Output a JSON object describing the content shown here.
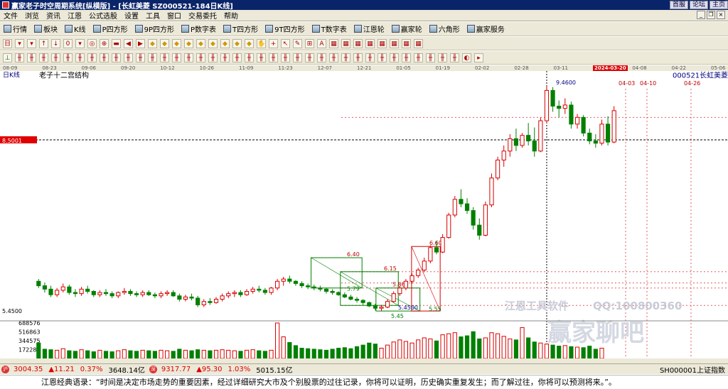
{
  "window": {
    "title": "赢家老子时空周期系统[纵横版] - [长虹美菱  SZ000521-184日K线]",
    "buttons": [
      "首服",
      "论坛",
      "主页"
    ]
  },
  "menu": [
    "文件",
    "浏览",
    "资讯",
    "江恩",
    "公式选股",
    "设置",
    "工具",
    "窗口",
    "交易委托",
    "帮助"
  ],
  "toolbar1": [
    "行情",
    "板块",
    "K线",
    "P四方形",
    "9P四方形",
    "P数字表",
    "T四方形",
    "9T四方形",
    "T数字表",
    "江恩轮",
    "赢家轮",
    "六角形",
    "赢家服务"
  ],
  "toolbar2_icons": [
    "日",
    "▾",
    "▾",
    "↑",
    "↓",
    "0",
    "▾",
    "◎",
    "⊕",
    "▬",
    "◀",
    "▶",
    "◆",
    "◆",
    "◆",
    "◆",
    "◆",
    "◆",
    "◆",
    "◆",
    "◆",
    "✋",
    "+",
    "↖",
    "✎",
    "⊞",
    "A",
    "▦",
    "▦",
    "▦",
    "▦",
    "▦",
    "▦",
    "▦",
    "▦"
  ],
  "toolbar3_icons": [
    "⊥",
    "╫",
    "╫",
    "╫",
    "╫",
    "╫",
    "╫",
    "╫",
    "╫",
    "╫",
    "╫",
    "╫",
    "╫",
    "╫",
    "╫",
    "╫",
    "╫",
    "╫",
    "╫",
    "╫",
    "╫",
    "╫",
    "╫",
    "╫",
    "╫",
    "╫",
    "╫",
    "╫",
    "╫",
    "╫",
    "╫",
    "╫",
    "╫",
    "╫",
    "╫",
    "╫",
    "╫",
    "╫",
    "◐",
    "▸"
  ],
  "colors": {
    "up": "#d80000",
    "down": "#008000",
    "bg": "#ffffff",
    "panel": "#ece9d8",
    "accent": "#000080"
  },
  "chart_data": {
    "type": "candlestick",
    "period_label": "日K线",
    "indicator_title": "老子十二宫结构",
    "security": {
      "code": "000521",
      "name": "长虹美菱"
    },
    "x_dates": [
      "08-09",
      "08-23",
      "09-06",
      "09-20",
      "10-12",
      "10-26",
      "11-09",
      "11-23",
      "12-07",
      "12-21",
      "01-05",
      "01-19",
      "02-02",
      "02-28",
      "03-11",
      "2024-03-20",
      "04-08",
      "04-22",
      "05-06"
    ],
    "highlight_date": "2024-03-20",
    "y_axis_labels": [
      "8.5001",
      "5.4500"
    ],
    "y_marker_value": 8.5001,
    "volume_axis_labels": [
      "688576",
      "516863",
      "344575",
      "172288"
    ],
    "price_annotations": [
      "9.4600",
      "6.60",
      "6.40",
      "6.15",
      "5.86",
      "5.79",
      "5.45",
      "5.4500",
      "5.55"
    ],
    "future_dates": [
      "04-03",
      "04-10",
      "04-26"
    ],
    "series": [
      {
        "open": 5.98,
        "high": 6.02,
        "low": 5.86,
        "close": 5.9
      },
      {
        "open": 5.9,
        "high": 5.96,
        "low": 5.78,
        "close": 5.84
      },
      {
        "open": 5.84,
        "high": 5.9,
        "low": 5.7,
        "close": 5.74
      },
      {
        "open": 5.74,
        "high": 5.86,
        "low": 5.7,
        "close": 5.82
      },
      {
        "open": 5.82,
        "high": 5.94,
        "low": 5.78,
        "close": 5.88
      },
      {
        "open": 5.88,
        "high": 5.92,
        "low": 5.74,
        "close": 5.78
      },
      {
        "open": 5.78,
        "high": 5.84,
        "low": 5.7,
        "close": 5.76
      },
      {
        "open": 5.76,
        "high": 5.88,
        "low": 5.72,
        "close": 5.84
      },
      {
        "open": 5.84,
        "high": 5.9,
        "low": 5.76,
        "close": 5.8
      },
      {
        "open": 5.8,
        "high": 5.82,
        "low": 5.7,
        "close": 5.74
      },
      {
        "open": 5.74,
        "high": 5.82,
        "low": 5.7,
        "close": 5.78
      },
      {
        "open": 5.78,
        "high": 5.84,
        "low": 5.72,
        "close": 5.76
      },
      {
        "open": 5.76,
        "high": 5.8,
        "low": 5.68,
        "close": 5.72
      },
      {
        "open": 5.72,
        "high": 5.8,
        "low": 5.68,
        "close": 5.78
      },
      {
        "open": 5.78,
        "high": 5.86,
        "low": 5.74,
        "close": 5.8
      },
      {
        "open": 5.8,
        "high": 5.84,
        "low": 5.72,
        "close": 5.76
      },
      {
        "open": 5.76,
        "high": 5.8,
        "low": 5.7,
        "close": 5.74
      },
      {
        "open": 5.74,
        "high": 5.82,
        "low": 5.7,
        "close": 5.78
      },
      {
        "open": 5.78,
        "high": 5.82,
        "low": 5.72,
        "close": 5.74
      },
      {
        "open": 5.74,
        "high": 5.78,
        "low": 5.68,
        "close": 5.72
      },
      {
        "open": 5.72,
        "high": 5.8,
        "low": 5.68,
        "close": 5.76
      },
      {
        "open": 5.76,
        "high": 5.82,
        "low": 5.72,
        "close": 5.78
      },
      {
        "open": 5.78,
        "high": 5.82,
        "low": 5.7,
        "close": 5.72
      },
      {
        "open": 5.72,
        "high": 5.76,
        "low": 5.62,
        "close": 5.66
      },
      {
        "open": 5.66,
        "high": 5.74,
        "low": 5.62,
        "close": 5.7
      },
      {
        "open": 5.7,
        "high": 5.76,
        "low": 5.64,
        "close": 5.68
      },
      {
        "open": 5.68,
        "high": 5.72,
        "low": 5.52,
        "close": 5.56
      },
      {
        "open": 5.56,
        "high": 5.66,
        "low": 5.52,
        "close": 5.62
      },
      {
        "open": 5.62,
        "high": 5.68,
        "low": 5.56,
        "close": 5.6
      },
      {
        "open": 5.6,
        "high": 5.7,
        "low": 5.58,
        "close": 5.66
      },
      {
        "open": 5.66,
        "high": 5.76,
        "low": 5.62,
        "close": 5.72
      },
      {
        "open": 5.72,
        "high": 5.8,
        "low": 5.68,
        "close": 5.76
      },
      {
        "open": 5.76,
        "high": 5.82,
        "low": 5.7,
        "close": 5.78
      },
      {
        "open": 5.78,
        "high": 5.82,
        "low": 5.7,
        "close": 5.74
      },
      {
        "open": 5.74,
        "high": 5.84,
        "low": 5.72,
        "close": 5.8
      },
      {
        "open": 5.8,
        "high": 5.88,
        "low": 5.76,
        "close": 5.84
      },
      {
        "open": 5.84,
        "high": 5.9,
        "low": 5.78,
        "close": 5.82
      },
      {
        "open": 5.82,
        "high": 5.86,
        "low": 5.74,
        "close": 5.78
      },
      {
        "open": 5.78,
        "high": 5.88,
        "low": 5.74,
        "close": 5.86
      },
      {
        "open": 5.86,
        "high": 6.02,
        "low": 5.82,
        "close": 5.98
      },
      {
        "open": 5.98,
        "high": 6.06,
        "low": 5.9,
        "close": 6.02
      },
      {
        "open": 6.02,
        "high": 6.08,
        "low": 5.94,
        "close": 5.98
      },
      {
        "open": 5.98,
        "high": 6.0,
        "low": 5.9,
        "close": 5.94
      },
      {
        "open": 5.94,
        "high": 5.98,
        "low": 5.86,
        "close": 5.9
      },
      {
        "open": 5.9,
        "high": 5.94,
        "low": 5.84,
        "close": 5.88
      },
      {
        "open": 5.88,
        "high": 5.92,
        "low": 5.82,
        "close": 5.86
      },
      {
        "open": 5.86,
        "high": 5.9,
        "low": 5.8,
        "close": 5.84
      },
      {
        "open": 5.84,
        "high": 5.86,
        "low": 5.76,
        "close": 5.8
      },
      {
        "open": 5.8,
        "high": 5.84,
        "low": 5.74,
        "close": 5.78
      },
      {
        "open": 5.78,
        "high": 5.8,
        "low": 5.72,
        "close": 5.74
      },
      {
        "open": 5.74,
        "high": 5.78,
        "low": 5.68,
        "close": 5.7
      },
      {
        "open": 5.7,
        "high": 5.74,
        "low": 5.64,
        "close": 5.66
      },
      {
        "open": 5.66,
        "high": 5.7,
        "low": 5.6,
        "close": 5.64
      },
      {
        "open": 5.64,
        "high": 5.66,
        "low": 5.56,
        "close": 5.6
      },
      {
        "open": 5.6,
        "high": 5.62,
        "low": 5.52,
        "close": 5.54
      },
      {
        "open": 5.54,
        "high": 5.58,
        "low": 5.46,
        "close": 5.5
      },
      {
        "open": 5.5,
        "high": 5.56,
        "low": 5.45,
        "close": 5.52
      },
      {
        "open": 5.52,
        "high": 5.66,
        "low": 5.5,
        "close": 5.62
      },
      {
        "open": 5.62,
        "high": 5.8,
        "low": 5.6,
        "close": 5.76
      },
      {
        "open": 5.76,
        "high": 5.9,
        "low": 5.72,
        "close": 5.86
      },
      {
        "open": 5.86,
        "high": 6.02,
        "low": 5.82,
        "close": 5.98
      },
      {
        "open": 5.98,
        "high": 6.12,
        "low": 5.94,
        "close": 6.08
      },
      {
        "open": 6.08,
        "high": 6.22,
        "low": 6.04,
        "close": 6.18
      },
      {
        "open": 6.18,
        "high": 6.4,
        "low": 6.14,
        "close": 6.34
      },
      {
        "open": 6.34,
        "high": 6.62,
        "low": 6.3,
        "close": 6.58
      },
      {
        "open": 6.58,
        "high": 6.7,
        "low": 6.46,
        "close": 6.5
      },
      {
        "open": 6.5,
        "high": 6.82,
        "low": 6.48,
        "close": 6.76
      },
      {
        "open": 6.76,
        "high": 7.2,
        "low": 6.74,
        "close": 7.16
      },
      {
        "open": 7.16,
        "high": 7.5,
        "low": 7.12,
        "close": 7.44
      },
      {
        "open": 7.44,
        "high": 7.62,
        "low": 7.3,
        "close": 7.36
      },
      {
        "open": 7.36,
        "high": 7.46,
        "low": 7.18,
        "close": 7.24
      },
      {
        "open": 7.24,
        "high": 7.3,
        "low": 6.9,
        "close": 6.98
      },
      {
        "open": 6.98,
        "high": 7.1,
        "low": 6.72,
        "close": 6.8
      },
      {
        "open": 6.8,
        "high": 7.4,
        "low": 6.78,
        "close": 7.34
      },
      {
        "open": 7.34,
        "high": 7.9,
        "low": 7.3,
        "close": 7.82
      },
      {
        "open": 7.82,
        "high": 8.2,
        "low": 7.78,
        "close": 8.14
      },
      {
        "open": 8.14,
        "high": 8.4,
        "low": 8.02,
        "close": 8.3
      },
      {
        "open": 8.3,
        "high": 8.6,
        "low": 8.2,
        "close": 8.52
      },
      {
        "open": 8.52,
        "high": 8.7,
        "low": 8.3,
        "close": 8.4
      },
      {
        "open": 8.4,
        "high": 8.62,
        "low": 8.36,
        "close": 8.58
      },
      {
        "open": 8.58,
        "high": 8.8,
        "low": 8.4,
        "close": 8.48
      },
      {
        "open": 8.48,
        "high": 8.72,
        "low": 8.2,
        "close": 8.3
      },
      {
        "open": 8.3,
        "high": 8.9,
        "low": 8.28,
        "close": 8.84
      },
      {
        "open": 8.84,
        "high": 9.46,
        "low": 8.8,
        "close": 9.38
      },
      {
        "open": 9.38,
        "high": 9.44,
        "low": 9.0,
        "close": 9.1
      },
      {
        "open": 9.1,
        "high": 9.2,
        "low": 8.9,
        "close": 9.06
      },
      {
        "open": 9.06,
        "high": 9.24,
        "low": 8.96,
        "close": 9.12
      },
      {
        "open": 9.12,
        "high": 9.18,
        "low": 8.7,
        "close": 8.78
      },
      {
        "open": 8.78,
        "high": 8.96,
        "low": 8.7,
        "close": 8.9
      },
      {
        "open": 8.9,
        "high": 8.94,
        "low": 8.56,
        "close": 8.62
      },
      {
        "open": 8.62,
        "high": 8.7,
        "low": 8.42,
        "close": 8.48
      },
      {
        "open": 8.48,
        "high": 8.6,
        "low": 8.36,
        "close": 8.44
      },
      {
        "open": 8.44,
        "high": 8.86,
        "low": 8.4,
        "close": 8.78
      },
      {
        "open": 8.78,
        "high": 8.92,
        "low": 8.4,
        "close": 8.46
      },
      {
        "open": 8.46,
        "high": 9.1,
        "low": 8.44,
        "close": 9.02
      }
    ],
    "volume": [
      300000,
      180000,
      170000,
      160000,
      190000,
      150000,
      140000,
      170000,
      150000,
      130000,
      160000,
      140000,
      130000,
      150000,
      170000,
      150000,
      140000,
      160000,
      150000,
      140000,
      160000,
      150000,
      140000,
      180000,
      160000,
      150000,
      170000,
      160000,
      150000,
      160000,
      170000,
      160000,
      150000,
      140000,
      160000,
      170000,
      150000,
      140000,
      160000,
      688576,
      420000,
      310000,
      250000,
      200000,
      190000,
      180000,
      170000,
      160000,
      180000,
      200000,
      210000,
      190000,
      230000,
      260000,
      300000,
      280000,
      200000,
      260000,
      320000,
      360000,
      330000,
      300000,
      360000,
      400000,
      380000,
      340000,
      460000,
      480000,
      500000,
      420000,
      440000,
      520000,
      380000,
      400000,
      500000,
      480000,
      430000,
      380000,
      360000,
      600000,
      400000,
      320000,
      300000,
      280000,
      260000,
      240000,
      250000,
      230000,
      220000,
      210000,
      240000,
      180000,
      200000
    ],
    "boxes": [
      {
        "x1": 0.405,
        "x2": 0.478,
        "y_top": 6.4,
        "y_bot": 5.86,
        "color": "green"
      },
      {
        "x1": 0.447,
        "x2": 0.53,
        "y_top": 6.15,
        "y_bot": 5.55,
        "color": "green"
      },
      {
        "x1": 0.498,
        "x2": 0.561,
        "y_top": 5.86,
        "y_bot": 5.45,
        "color": "green"
      },
      {
        "x1": 0.549,
        "x2": 0.59,
        "y_top": 6.6,
        "y_bot": 5.45,
        "color": "red"
      }
    ]
  },
  "watermark": {
    "line1": "江恩工具软件",
    "line2": "QQ:100800360",
    "logo": "赢家聊吧"
  },
  "statusbar": {
    "sh_index": "3004.35",
    "sh_change": "▲11.21",
    "sh_pct": "0.37%",
    "sh_amount": "3648.14亿",
    "sz_index": "9317.77",
    "sz_change": "▲95.30",
    "sz_pct": "1.03%",
    "sz_amount": "5015.15亿",
    "right_label": "SH000001上证指数"
  },
  "quote": "江恩经典语录：“时间是决定市场走势的重要因素，经过详细研究大市及个别股票的过往记录，你将可以证明，历史确实重复发生；而了解过往，你将可以预测将来。”。"
}
